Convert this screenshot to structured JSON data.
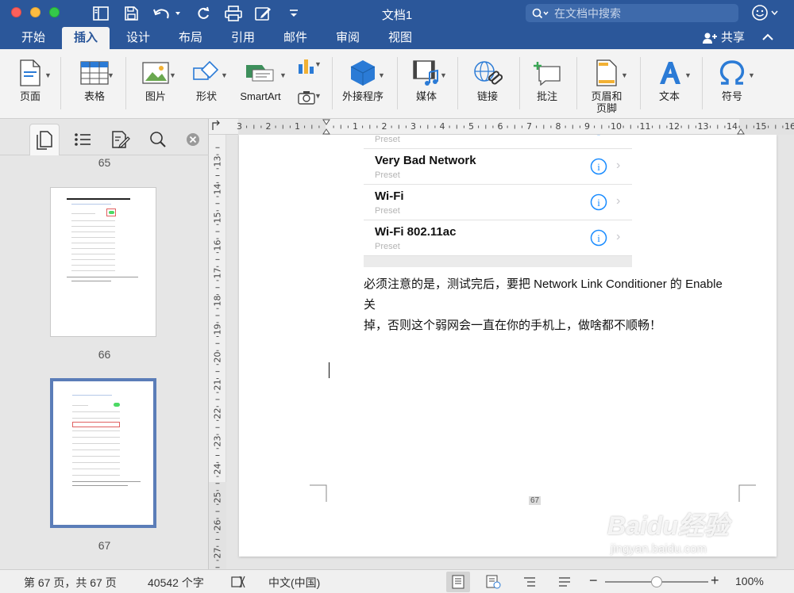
{
  "window": {
    "title": "文档1"
  },
  "search": {
    "placeholder": "在文档中搜索"
  },
  "tabs": [
    {
      "label": "开始"
    },
    {
      "label": "插入"
    },
    {
      "label": "设计"
    },
    {
      "label": "布局"
    },
    {
      "label": "引用"
    },
    {
      "label": "邮件"
    },
    {
      "label": "审阅"
    },
    {
      "label": "视图"
    }
  ],
  "active_tab": "插入",
  "share_label": "共享",
  "ribbon": {
    "page": "页面",
    "table": "表格",
    "picture": "图片",
    "shapes": "形状",
    "smartart": "SmartArt",
    "addins": "外接程序",
    "media": "媒体",
    "link": "链接",
    "comment": "批注",
    "header_footer_1": "页眉和",
    "header_footer_2": "页脚",
    "text": "文本",
    "symbol": "符号"
  },
  "nav_pane": {
    "page_numbers": [
      "65",
      "66",
      "67"
    ],
    "selected_page": "67"
  },
  "hruler_labels": [
    "3",
    "2",
    "1",
    "1",
    "2",
    "3",
    "4",
    "5",
    "6",
    "7",
    "8",
    "9",
    "10",
    "11",
    "12",
    "13",
    "14",
    "15",
    "16"
  ],
  "vruler_labels": [
    "13",
    "14",
    "15",
    "16",
    "17",
    "18",
    "19",
    "20",
    "21",
    "22",
    "23",
    "24",
    "25",
    "26",
    "27"
  ],
  "document": {
    "top_row_sub": "Preset",
    "wifi_rows": [
      {
        "name": "Very Bad Network",
        "sub": "Preset"
      },
      {
        "name": "Wi-Fi",
        "sub": "Preset"
      },
      {
        "name": "Wi-Fi 802.11ac",
        "sub": "Preset"
      }
    ],
    "paragraph_line1": "必须注意的是，测试完后，要把 Network Link Conditioner 的 Enable 关",
    "paragraph_line2": "掉，否则这个弱网会一直在你的手机上，做啥都不顺畅！",
    "page_number": "67"
  },
  "status": {
    "page": "第 67 页，共 67 页",
    "words": "40542 个字",
    "language": "中文(中国)",
    "zoom": "100%",
    "zoom_level": 0.5
  },
  "watermark": {
    "brand": "Baidu经验",
    "url": "jingyan.baidu.com"
  },
  "colors": {
    "word_blue": "#2b579a",
    "info_blue": "#1a8cff"
  }
}
